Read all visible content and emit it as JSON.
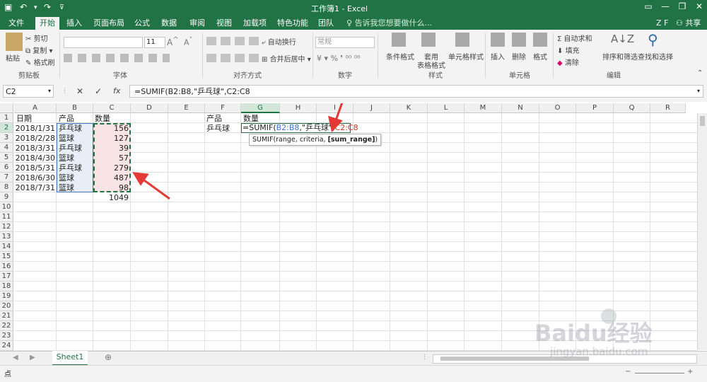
{
  "titlebar": {
    "title": "工作簿1 - Excel"
  },
  "tabs": [
    "文件",
    "开始",
    "插入",
    "页面布局",
    "公式",
    "数据",
    "审阅",
    "视图",
    "加载项",
    "特色功能",
    "团队"
  ],
  "tell_me": "告诉我您想要做什么...",
  "user": "Z F",
  "share": "共享",
  "ribbon": {
    "clipboard": {
      "cut": "剪切",
      "copy": "复制",
      "paste": "粘贴",
      "format_painter": "格式刷",
      "group": "剪贴板"
    },
    "font": {
      "size": "11",
      "group": "字体"
    },
    "alignment": {
      "wrap": "自动换行",
      "merge": "合并后居中",
      "group": "对齐方式"
    },
    "number": {
      "format": "常规",
      "group": "数字"
    },
    "styles": {
      "cond": "条件格式",
      "table1": "套用",
      "table2": "表格格式",
      "cell": "单元格样式",
      "group": "样式"
    },
    "cells": {
      "insert": "插入",
      "delete": "删除",
      "format": "格式",
      "group": "单元格"
    },
    "editing": {
      "autosum": "Σ 自动求和",
      "fill": "填充",
      "clear": "清除",
      "sort": "排序和筛选",
      "find": "查找和选择",
      "group": "编辑"
    }
  },
  "formula_bar": {
    "name_box": "C2",
    "formula": "=SUMIF(B2:B8,\"乒乓球\",C2:C8"
  },
  "columns": [
    "A",
    "B",
    "C",
    "D",
    "E",
    "F",
    "G",
    "H",
    "I",
    "J",
    "K",
    "L",
    "M",
    "N",
    "O",
    "P",
    "Q",
    "R"
  ],
  "rows": [
    "1",
    "2",
    "3",
    "4",
    "5",
    "6",
    "7",
    "8",
    "9",
    "10",
    "11",
    "12",
    "13",
    "14",
    "15",
    "16",
    "17",
    "18",
    "19",
    "20",
    "21",
    "22",
    "23",
    "24"
  ],
  "table": {
    "headers": [
      "日期",
      "产品",
      "数量"
    ],
    "dates": [
      "2018/1/31",
      "2018/2/28",
      "2018/3/31",
      "2018/4/30",
      "2018/5/31",
      "2018/6/30",
      "2018/7/31"
    ],
    "products": [
      "乒乓球",
      "篮球",
      "乒乓球",
      "篮球",
      "乒乓球",
      "篮球",
      "篮球"
    ],
    "quantities": [
      "156",
      "127",
      "39",
      "57",
      "279",
      "487",
      "98"
    ],
    "total": "1049"
  },
  "side": {
    "f1": "产品",
    "g1": "数量",
    "f2": "乒乓球",
    "edit_prefix": "=SUMIF(",
    "edit_range1": "B2:B8",
    "edit_mid": ",\"乒乓球\",",
    "edit_range2": "C2:C8"
  },
  "tooltip": {
    "text": "SUMIF(range, criteria, ",
    "bold": "[sum_range]",
    "close": ")"
  },
  "sheet_tab": "Sheet1",
  "status": {
    "mode": "点"
  },
  "watermark": {
    "brand": "Baidu经验",
    "url": "jingyan.baidu.com"
  }
}
